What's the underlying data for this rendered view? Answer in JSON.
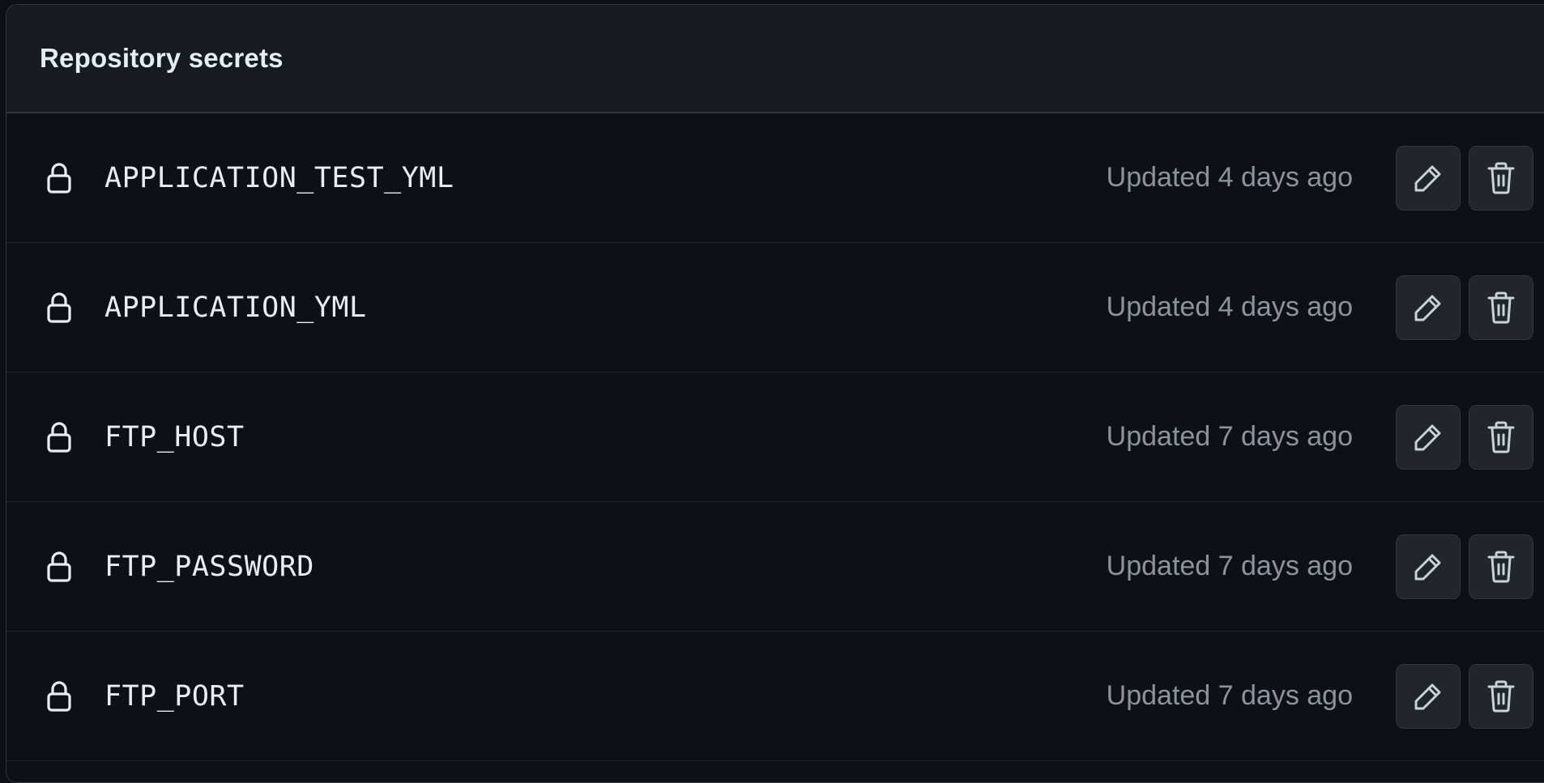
{
  "section": {
    "title": "Repository secrets"
  },
  "secrets": [
    {
      "name": "APPLICATION_TEST_YML",
      "updated": "Updated 4 days ago"
    },
    {
      "name": "APPLICATION_YML",
      "updated": "Updated 4 days ago"
    },
    {
      "name": "FTP_HOST",
      "updated": "Updated 7 days ago"
    },
    {
      "name": "FTP_PASSWORD",
      "updated": "Updated 7 days ago"
    },
    {
      "name": "FTP_PORT",
      "updated": "Updated 7 days ago"
    }
  ],
  "icons": {
    "row": "lock-icon",
    "edit": "pencil-icon",
    "delete": "trash-icon"
  },
  "colors": {
    "background": "#0d1117",
    "header_background": "#161b22",
    "border": "#30363d",
    "text_primary": "#e6edf3",
    "text_muted": "#8b949e",
    "button_background": "#21262d"
  }
}
